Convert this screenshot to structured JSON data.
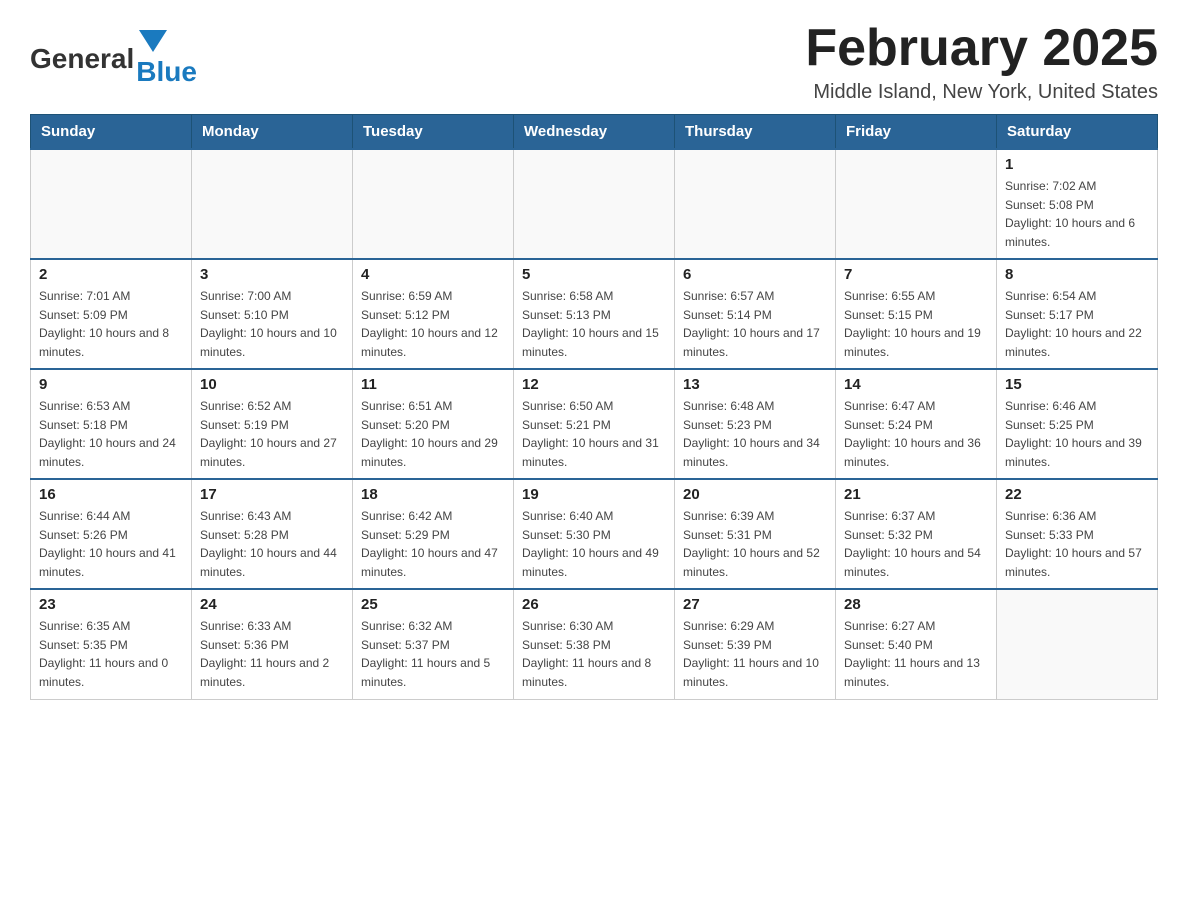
{
  "header": {
    "logo": {
      "text_general": "General",
      "text_blue": "Blue",
      "triangle_label": "logo-triangle"
    },
    "title": "February 2025",
    "subtitle": "Middle Island, New York, United States"
  },
  "weekdays": [
    "Sunday",
    "Monday",
    "Tuesday",
    "Wednesday",
    "Thursday",
    "Friday",
    "Saturday"
  ],
  "weeks": [
    [
      {
        "day": "",
        "info": ""
      },
      {
        "day": "",
        "info": ""
      },
      {
        "day": "",
        "info": ""
      },
      {
        "day": "",
        "info": ""
      },
      {
        "day": "",
        "info": ""
      },
      {
        "day": "",
        "info": ""
      },
      {
        "day": "1",
        "info": "Sunrise: 7:02 AM\nSunset: 5:08 PM\nDaylight: 10 hours and 6 minutes."
      }
    ],
    [
      {
        "day": "2",
        "info": "Sunrise: 7:01 AM\nSunset: 5:09 PM\nDaylight: 10 hours and 8 minutes."
      },
      {
        "day": "3",
        "info": "Sunrise: 7:00 AM\nSunset: 5:10 PM\nDaylight: 10 hours and 10 minutes."
      },
      {
        "day": "4",
        "info": "Sunrise: 6:59 AM\nSunset: 5:12 PM\nDaylight: 10 hours and 12 minutes."
      },
      {
        "day": "5",
        "info": "Sunrise: 6:58 AM\nSunset: 5:13 PM\nDaylight: 10 hours and 15 minutes."
      },
      {
        "day": "6",
        "info": "Sunrise: 6:57 AM\nSunset: 5:14 PM\nDaylight: 10 hours and 17 minutes."
      },
      {
        "day": "7",
        "info": "Sunrise: 6:55 AM\nSunset: 5:15 PM\nDaylight: 10 hours and 19 minutes."
      },
      {
        "day": "8",
        "info": "Sunrise: 6:54 AM\nSunset: 5:17 PM\nDaylight: 10 hours and 22 minutes."
      }
    ],
    [
      {
        "day": "9",
        "info": "Sunrise: 6:53 AM\nSunset: 5:18 PM\nDaylight: 10 hours and 24 minutes."
      },
      {
        "day": "10",
        "info": "Sunrise: 6:52 AM\nSunset: 5:19 PM\nDaylight: 10 hours and 27 minutes."
      },
      {
        "day": "11",
        "info": "Sunrise: 6:51 AM\nSunset: 5:20 PM\nDaylight: 10 hours and 29 minutes."
      },
      {
        "day": "12",
        "info": "Sunrise: 6:50 AM\nSunset: 5:21 PM\nDaylight: 10 hours and 31 minutes."
      },
      {
        "day": "13",
        "info": "Sunrise: 6:48 AM\nSunset: 5:23 PM\nDaylight: 10 hours and 34 minutes."
      },
      {
        "day": "14",
        "info": "Sunrise: 6:47 AM\nSunset: 5:24 PM\nDaylight: 10 hours and 36 minutes."
      },
      {
        "day": "15",
        "info": "Sunrise: 6:46 AM\nSunset: 5:25 PM\nDaylight: 10 hours and 39 minutes."
      }
    ],
    [
      {
        "day": "16",
        "info": "Sunrise: 6:44 AM\nSunset: 5:26 PM\nDaylight: 10 hours and 41 minutes."
      },
      {
        "day": "17",
        "info": "Sunrise: 6:43 AM\nSunset: 5:28 PM\nDaylight: 10 hours and 44 minutes."
      },
      {
        "day": "18",
        "info": "Sunrise: 6:42 AM\nSunset: 5:29 PM\nDaylight: 10 hours and 47 minutes."
      },
      {
        "day": "19",
        "info": "Sunrise: 6:40 AM\nSunset: 5:30 PM\nDaylight: 10 hours and 49 minutes."
      },
      {
        "day": "20",
        "info": "Sunrise: 6:39 AM\nSunset: 5:31 PM\nDaylight: 10 hours and 52 minutes."
      },
      {
        "day": "21",
        "info": "Sunrise: 6:37 AM\nSunset: 5:32 PM\nDaylight: 10 hours and 54 minutes."
      },
      {
        "day": "22",
        "info": "Sunrise: 6:36 AM\nSunset: 5:33 PM\nDaylight: 10 hours and 57 minutes."
      }
    ],
    [
      {
        "day": "23",
        "info": "Sunrise: 6:35 AM\nSunset: 5:35 PM\nDaylight: 11 hours and 0 minutes."
      },
      {
        "day": "24",
        "info": "Sunrise: 6:33 AM\nSunset: 5:36 PM\nDaylight: 11 hours and 2 minutes."
      },
      {
        "day": "25",
        "info": "Sunrise: 6:32 AM\nSunset: 5:37 PM\nDaylight: 11 hours and 5 minutes."
      },
      {
        "day": "26",
        "info": "Sunrise: 6:30 AM\nSunset: 5:38 PM\nDaylight: 11 hours and 8 minutes."
      },
      {
        "day": "27",
        "info": "Sunrise: 6:29 AM\nSunset: 5:39 PM\nDaylight: 11 hours and 10 minutes."
      },
      {
        "day": "28",
        "info": "Sunrise: 6:27 AM\nSunset: 5:40 PM\nDaylight: 11 hours and 13 minutes."
      },
      {
        "day": "",
        "info": ""
      }
    ]
  ]
}
